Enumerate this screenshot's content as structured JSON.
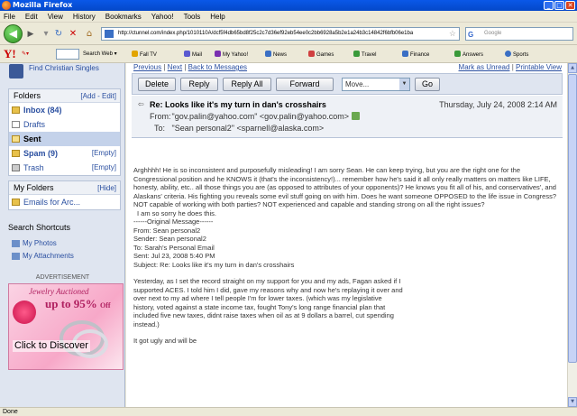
{
  "window": {
    "title": "Mozilla Firefox"
  },
  "menu": [
    "File",
    "Edit",
    "View",
    "History",
    "Bookmarks",
    "Yahoo!",
    "Tools",
    "Help"
  ],
  "nav": {
    "url": "http://ctunnel.com/index.php/1010110A/dcf5f4db65bd8f25c2c7d36ef92eb54ee0c2bb6928a5b2e1a24b3c14842f6bfb06e1ba",
    "search_placeholder": "Google"
  },
  "yahoo_toolbar": {
    "search_web": "Search Web",
    "items": [
      "Fall TV",
      "Mail",
      "My Yahoo!",
      "News",
      "Games",
      "Travel",
      "Finance",
      "Answers",
      "Sports"
    ]
  },
  "sidebar": {
    "promo": "Find Christian Singles",
    "folders_title": "Folders",
    "folders_actions": "[Add - Edit]",
    "folders": [
      {
        "label": "Inbox (84)",
        "action": ""
      },
      {
        "label": "Drafts",
        "action": ""
      },
      {
        "label": "Sent",
        "action": ""
      },
      {
        "label": "Spam (9)",
        "action": "[Empty]"
      },
      {
        "label": "Trash",
        "action": "[Empty]"
      }
    ],
    "my_folders_title": "My Folders",
    "my_folders_action": "[Hide]",
    "my_folders": [
      "Emails for Arc..."
    ],
    "shortcuts_title": "Search Shortcuts",
    "shortcuts": [
      "My Photos",
      "My Attachments"
    ],
    "ad_label": "ADVERTISEMENT",
    "ad": {
      "line1": "Jewelry Auctioned",
      "line2": "up to 95%",
      "line2b": "Off",
      "cta": "Click to Discover"
    }
  },
  "message": {
    "top_nav": [
      "Previous",
      "Next",
      "Back to Messages"
    ],
    "top_actions": [
      "Mark as Unread",
      "Printable View"
    ],
    "buttons": {
      "delete": "Delete",
      "reply": "Reply",
      "reply_all": "Reply All",
      "forward": "Forward",
      "go": "Go"
    },
    "move_select": "Move...",
    "subject": "Re: Looks like it's my turn in dan's crosshairs",
    "date": "Thursday, July 24, 2008 2:14 AM",
    "from_label": "From:",
    "from": "\"gov.palin@yahoo.com\" <gov.palin@yahoo.com>",
    "to_label": "To:",
    "to": "\"Sean personal2\" <sparnell@alaska.com>",
    "body_p1": "Arghhhh! He is so inconsistent and purposefully misleading! I am sorry Sean. He can keep trying, but you are the right one for the Congressional position and he KNOWS it (that's the inconsistency!)... remember how he's said it all only really matters on matters like LIFE, honesty, ability, etc.. all those things you are (as opposed to attributes of your opponents)? He knows you fit all of his, and conservatives', and Alaskans' criteria. His fighting you reveals some evil stuff going on with him. Does he want someone OPPOSED to the life issue in Congress? NOT capable of working with both parties? NOT experienced and capable and standing strong on all the right issues?",
    "body_p2": "I am so sorry he does this.",
    "quoted_header": "------Original Message------\nFrom: Sean personal2\nSender: Sean personal2\nTo: Sarah's Personal Email\nSent: Jul 23, 2008 5:40 PM\nSubject: Re: Looks like it's my turn in dan's crosshairs",
    "body_p3": "Yesterday, as I set the record straight on my support for you and my ads, Fagan asked if I supported ACES. I told him I did, gave my reasons why and now he's replaying it over and over next to my ad where I tell people I'm for lower taxes. (which was my legislative history, voted against a state income tax, fought Tony's long range financial plan that included five new taxes, didnt raise taxes when oil as at 9 dollars a barrel, cut spending instead.)",
    "body_p4": "It got ugly and will be"
  },
  "status": {
    "text": "Done"
  },
  "colors": {
    "accent": "#2a4fa0",
    "panel": "#dfe5f0",
    "titlebar": "#0a58e8"
  }
}
